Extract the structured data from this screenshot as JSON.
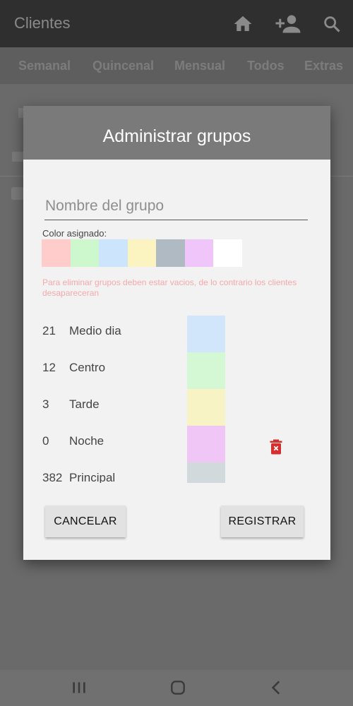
{
  "appbar": {
    "title": "Clientes",
    "icons": [
      "home-icon",
      "add-person-icon",
      "search-icon"
    ]
  },
  "tabs": [
    "Semanal",
    "Quincenal",
    "Mensual",
    "Todos",
    "Extras"
  ],
  "dialog": {
    "title": "Administrar grupos",
    "name_placeholder": "Nombre del grupo",
    "name_value": "",
    "color_label": "Color asignado:",
    "swatches": [
      "#ffcccc",
      "#cdf8cd",
      "#cce4fc",
      "#fbf3c0",
      "#b0bac2",
      "#f0c6fa",
      "#ffffff"
    ],
    "warning": "Para eliminar grupos deben estar vacios, de lo contrario los clientes desapareceran",
    "groups": [
      {
        "count": "21",
        "name": "Medio dia",
        "color": "#d1e6fb"
      },
      {
        "count": "12",
        "name": "Centro",
        "color": "#d4f7d4"
      },
      {
        "count": "3",
        "name": "Tarde",
        "color": "#f8f3c5"
      },
      {
        "count": "0",
        "name": "Noche",
        "color": "#f0c6f7",
        "deletable": true
      },
      {
        "count": "382",
        "name": "Principal",
        "color": "#d1d9dc"
      }
    ],
    "cancel_label": "CANCELAR",
    "register_label": "REGISTRAR"
  },
  "colors": {
    "delete": "#d32f2f"
  },
  "system_nav": [
    "recents-icon",
    "home-circle-icon",
    "back-icon"
  ]
}
